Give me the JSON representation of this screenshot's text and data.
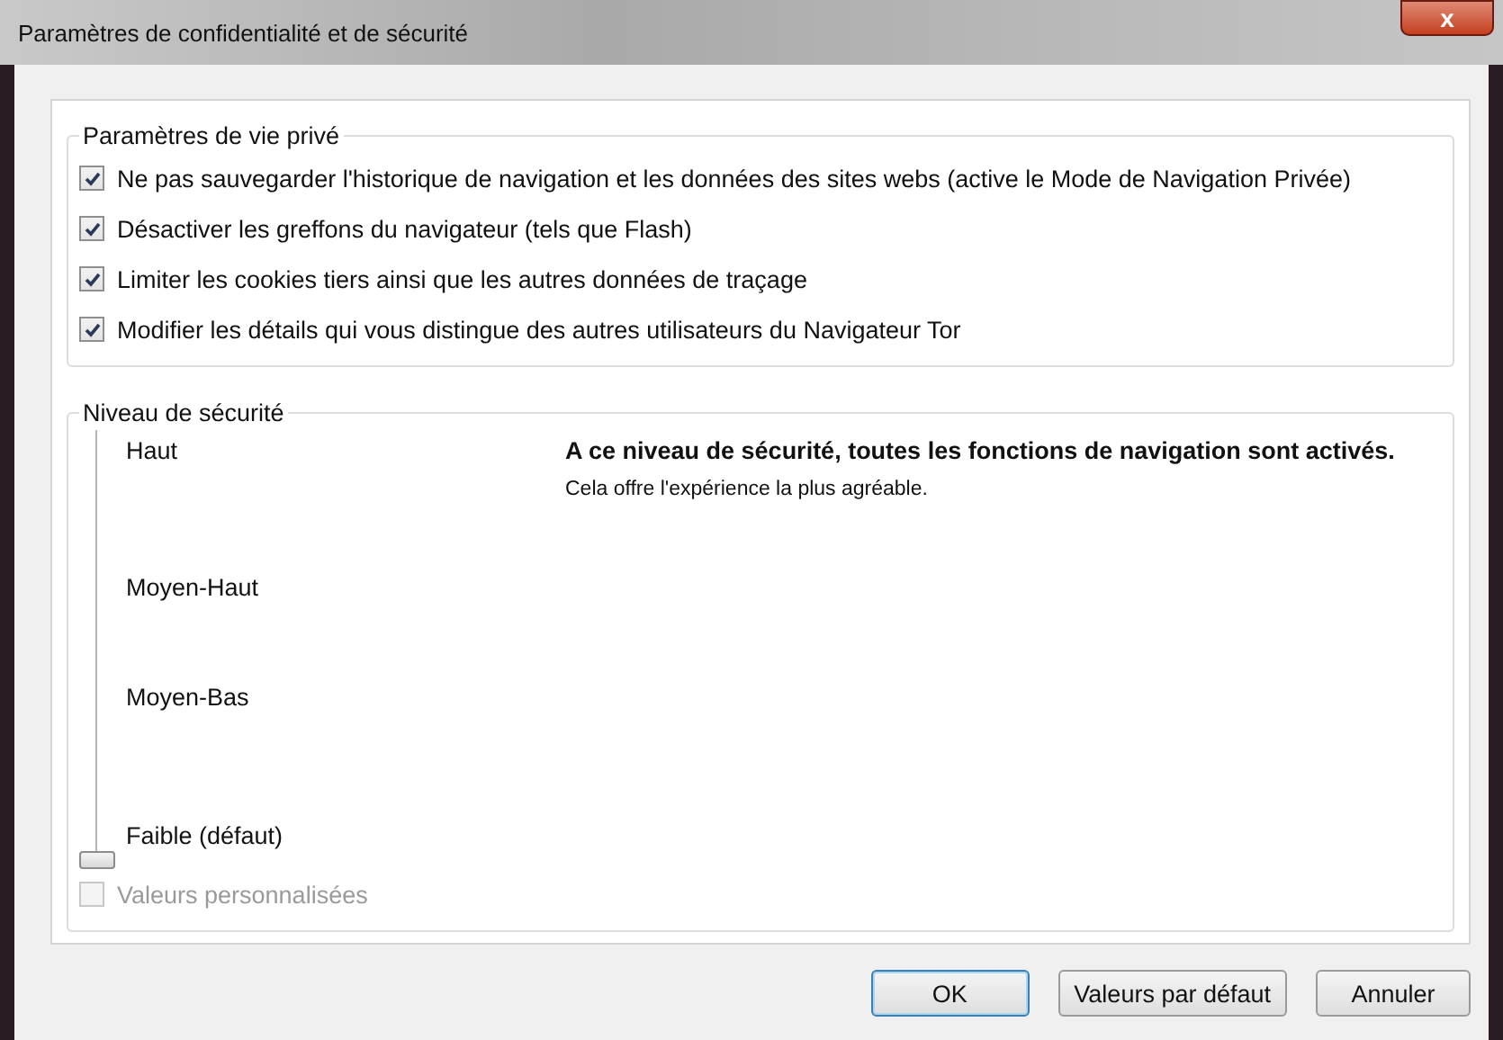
{
  "window": {
    "title": "Paramètres de confidentialité et de sécurité",
    "close": "x"
  },
  "privacy": {
    "legend": "Paramètres de vie privé",
    "options": [
      {
        "label": "Ne pas sauvegarder l'historique de navigation et les données des sites webs (active le Mode de Navigation Privée)",
        "checked": true
      },
      {
        "label": "Désactiver les greffons du navigateur (tels que Flash)",
        "checked": true
      },
      {
        "label": "Limiter les cookies tiers ainsi que les autres données de traçage",
        "checked": true
      },
      {
        "label": "Modifier les détails qui vous distingue des autres utilisateurs du Navigateur Tor",
        "checked": true
      }
    ]
  },
  "security": {
    "legend": "Niveau de sécurité",
    "level": 0,
    "stops": [
      "Haut",
      "Moyen-Haut",
      "Moyen-Bas",
      "Faible (défaut)"
    ],
    "heading": "A ce niveau de sécurité, toutes les fonctions de navigation sont activés.",
    "description": "Cela offre l'expérience la plus agréable.",
    "custom": {
      "label": "Valeurs personnalisées",
      "checked": false,
      "disabled": true
    }
  },
  "buttons": [
    {
      "label": "OK",
      "selected": true
    },
    {
      "label": "Valeurs par défaut",
      "selected": false
    },
    {
      "label": "Annuler",
      "selected": false
    }
  ]
}
